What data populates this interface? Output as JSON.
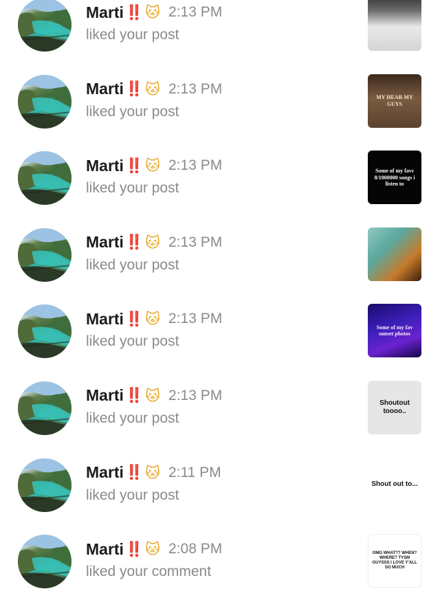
{
  "notifications": [
    {
      "user": "Marti",
      "emoji_bang": "‼️",
      "emoji_cat": "🐱",
      "time": "2:13 PM",
      "action": "liked your post",
      "thumb": {
        "style": "t1",
        "text": ""
      }
    },
    {
      "user": "Marti",
      "emoji_bang": "‼️",
      "emoji_cat": "🐱",
      "time": "2:13 PM",
      "action": "liked your post",
      "thumb": {
        "style": "t2",
        "text": "MY HEAR MY GUYS"
      }
    },
    {
      "user": "Marti",
      "emoji_bang": "‼️",
      "emoji_cat": "🐱",
      "time": "2:13 PM",
      "action": "liked your post",
      "thumb": {
        "style": "t3",
        "text": "Some of my favs 8/1000000 songs i listen to"
      }
    },
    {
      "user": "Marti",
      "emoji_bang": "‼️",
      "emoji_cat": "🐱",
      "time": "2:13 PM",
      "action": "liked your post",
      "thumb": {
        "style": "t4",
        "text": ""
      }
    },
    {
      "user": "Marti",
      "emoji_bang": "‼️",
      "emoji_cat": "🐱",
      "time": "2:13 PM",
      "action": "liked your post",
      "thumb": {
        "style": "t5",
        "text": "Some of my fav sunset photos"
      }
    },
    {
      "user": "Marti",
      "emoji_bang": "‼️",
      "emoji_cat": "🐱",
      "time": "2:13 PM",
      "action": "liked your post",
      "thumb": {
        "style": "t6",
        "text": "Shoutout toooo.."
      }
    },
    {
      "user": "Marti",
      "emoji_bang": "‼️",
      "emoji_cat": "🐱",
      "time": "2:11 PM",
      "action": "liked your post",
      "thumb": {
        "style": "t7",
        "text": "Shout out to..."
      }
    },
    {
      "user": "Marti",
      "emoji_bang": "‼️",
      "emoji_cat": "🐱",
      "time": "2:08 PM",
      "action": "liked your comment",
      "thumb": {
        "style": "t8",
        "text": "OMG WHAT?? WHEN? WHERE? TYSM GUYSSS I LOVE Y'ALL SO MUCH"
      }
    }
  ]
}
